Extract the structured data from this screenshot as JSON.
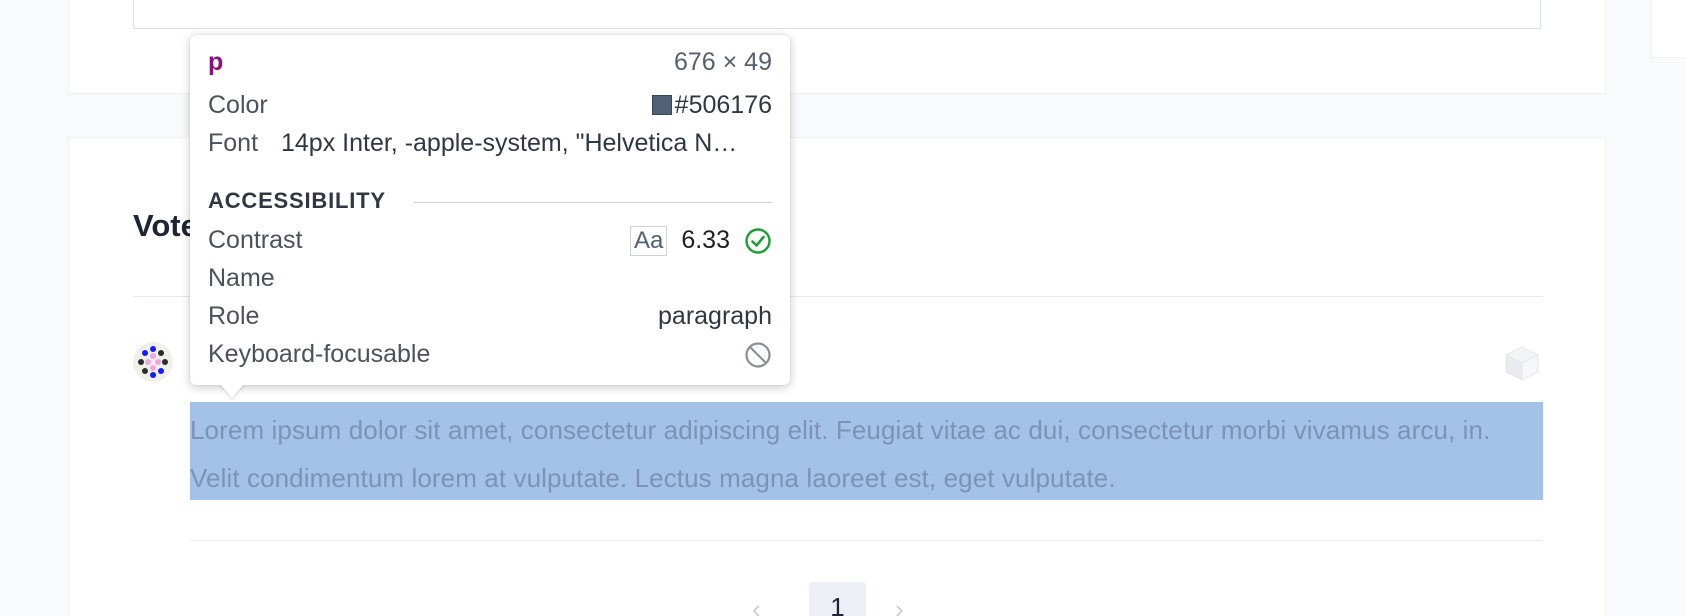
{
  "inspector": {
    "tag": "p",
    "dimensions": "676 × 49",
    "color_label": "Color",
    "color_value": "#506176",
    "font_label": "Font",
    "font_value": "14px Inter, -apple-system, \"Helvetica N…",
    "accessibility_heading": "ACCESSIBILITY",
    "contrast_label": "Contrast",
    "contrast_badge": "Aa",
    "contrast_value": "6.33",
    "name_label": "Name",
    "role_label": "Role",
    "role_value": "paragraph",
    "keyboard_label": "Keyboard-focusable",
    "icons": {
      "contrast_status": "check-circle-icon",
      "keyboard_status": "not-allowed-icon"
    }
  },
  "section": {
    "title": "Vote"
  },
  "comment": {
    "text": "Lorem ipsum dolor sit amet, consectetur adipiscing elit. Feugiat vitae ac dui, consectetur morbi vivamus arcu, in. Velit condimentum lorem at vulputate. Lectus magna laoreet est, eget vulputate."
  },
  "pagination": {
    "prev": "‹",
    "current": "1",
    "next": "›"
  },
  "colors": {
    "highlight": "#a4c2e8",
    "paragraph_text": "#506176",
    "tag": "#881280",
    "check": "#1e9e3a"
  }
}
